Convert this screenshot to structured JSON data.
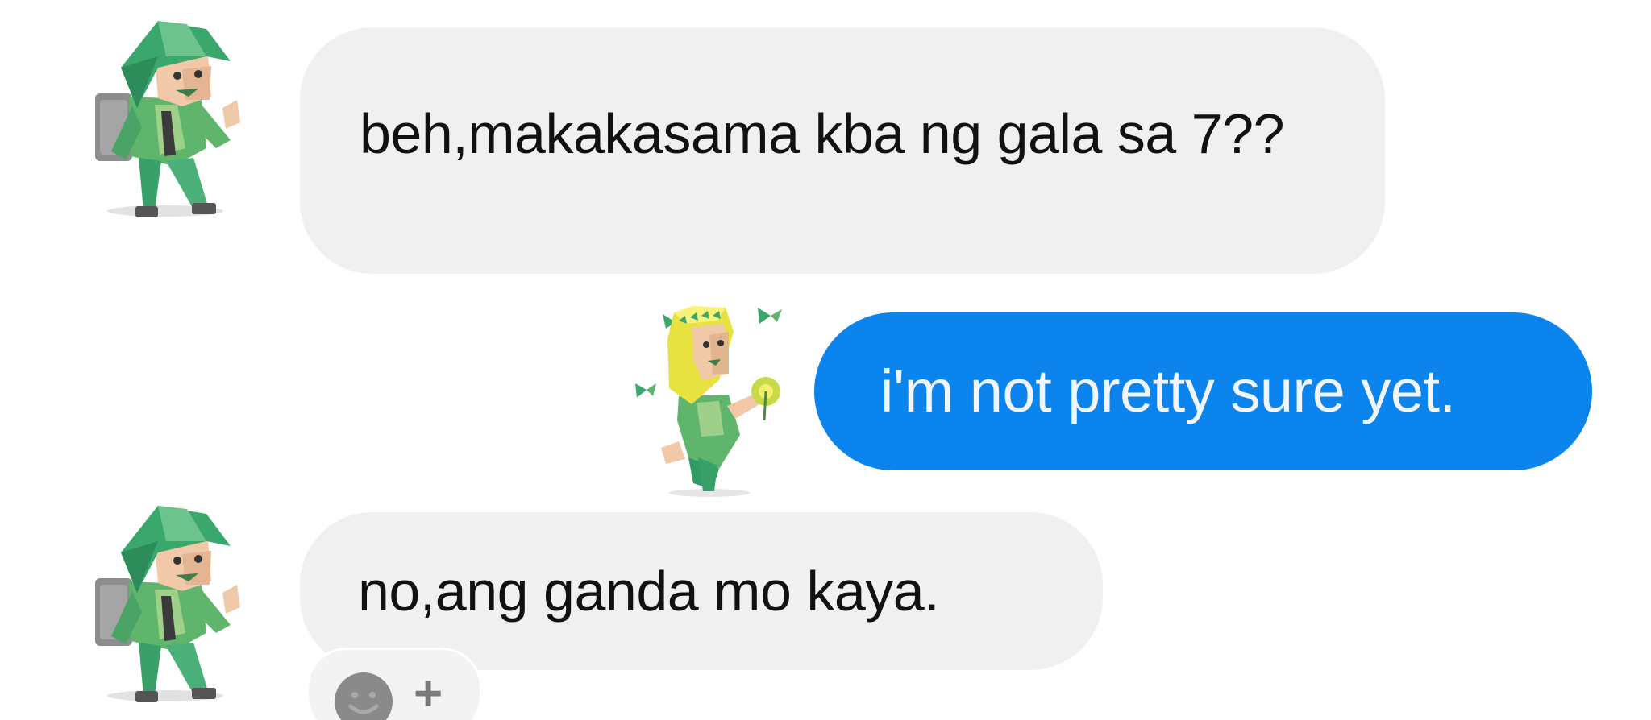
{
  "messages": [
    {
      "direction": "incoming",
      "text": "beh,makakasama kba ng gala sa 7??",
      "avatar_icon": "green-hooded-traveler-sticker-icon"
    },
    {
      "direction": "outgoing",
      "text": "i'm not pretty sure yet.",
      "avatar_icon": "yellow-haired-dancer-sticker-icon"
    },
    {
      "direction": "incoming",
      "text": "no,ang ganda mo kaya.",
      "avatar_icon": "green-hooded-traveler-sticker-icon"
    }
  ],
  "reaction_bar": {
    "icon": "add-reaction-smiley-icon",
    "plus": "+"
  },
  "colors": {
    "incoming_bubble": "#f0f0f0",
    "outgoing_bubble": "#0b84ee",
    "outgoing_text": "#f2f5fb",
    "incoming_text": "#111111"
  }
}
